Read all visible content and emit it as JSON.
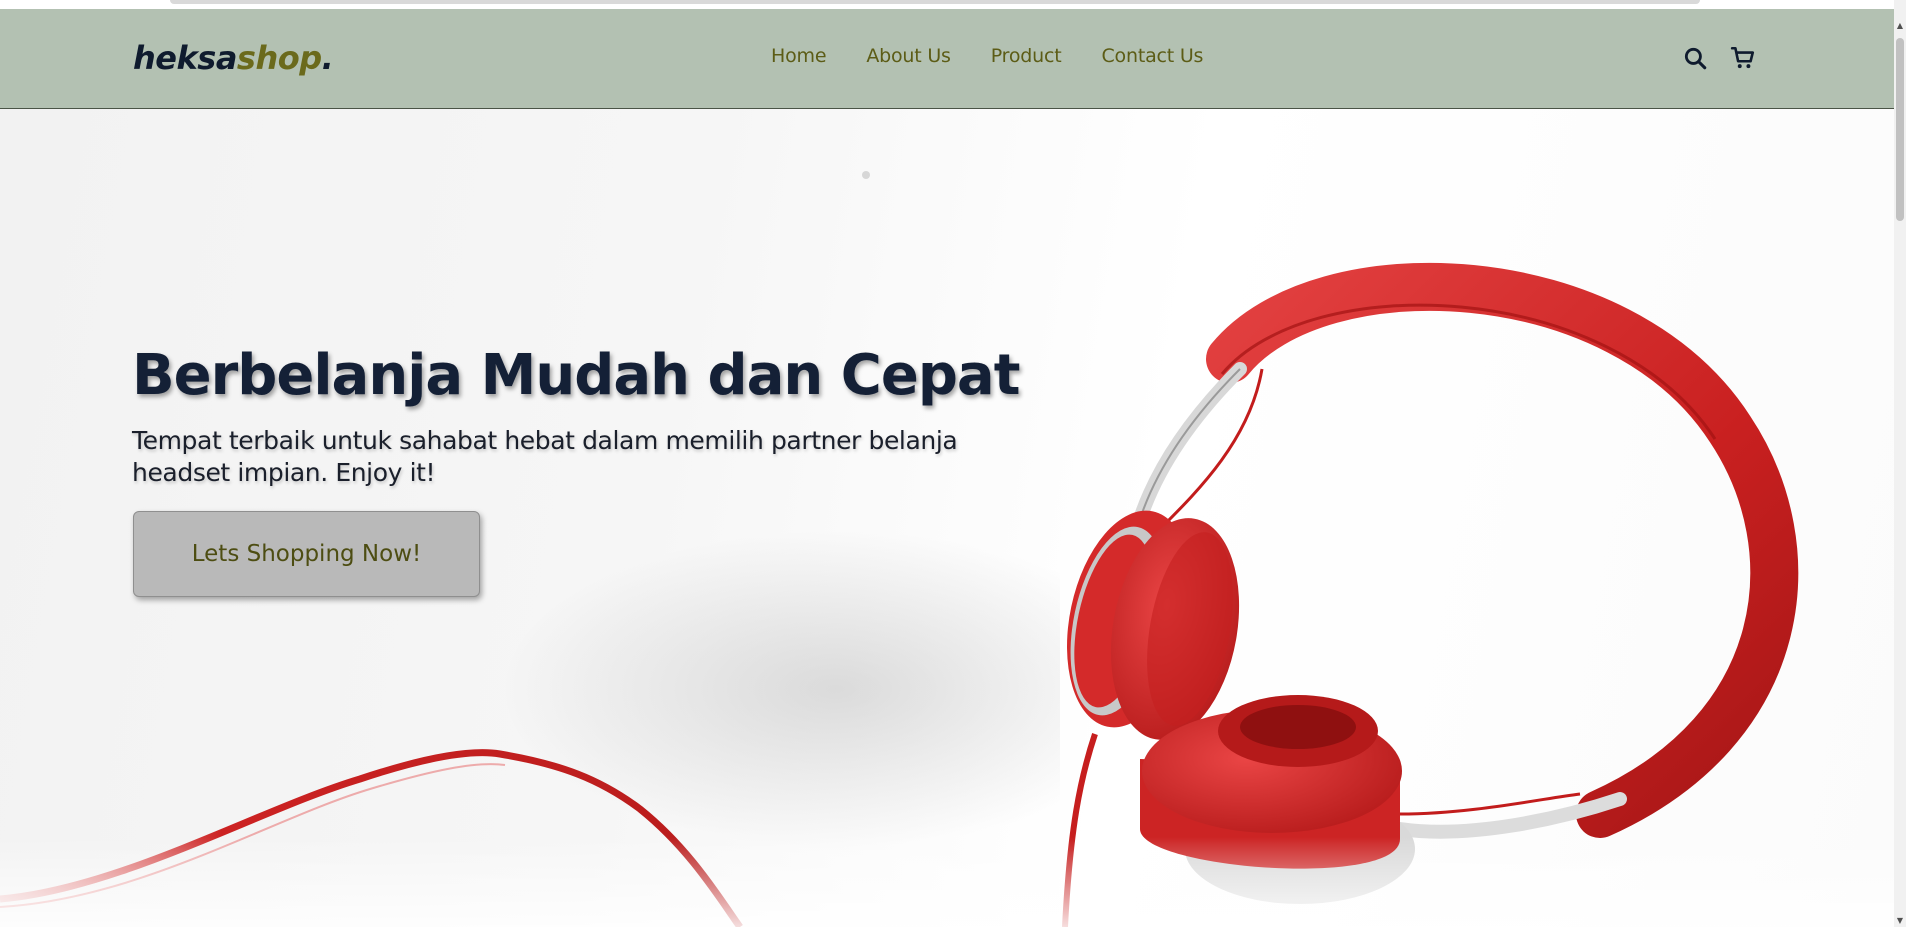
{
  "brand": {
    "part1": "heksa",
    "part2": "shop",
    "dot": "."
  },
  "nav": {
    "items": [
      {
        "label": "Home"
      },
      {
        "label": "About Us"
      },
      {
        "label": "Product"
      },
      {
        "label": "Contact Us"
      }
    ],
    "icons": [
      "search-icon",
      "cart-icon"
    ]
  },
  "hero": {
    "headline": "Berbelanja Mudah dan Cepat",
    "subtext": "Tempat terbaik untuk sahabat hebat dalam memilih partner belanja headset impian. Enjoy it!",
    "cta_label": "Lets Shopping Now!"
  },
  "colors": {
    "navbar_bg": "#b3c1b2",
    "brand_dark": "#0f1b2e",
    "brand_olive": "#6b6a1c",
    "nav_text": "#5c5c16",
    "headphone_red": "#d42a2a",
    "cta_bg": "#b9b9b9"
  }
}
